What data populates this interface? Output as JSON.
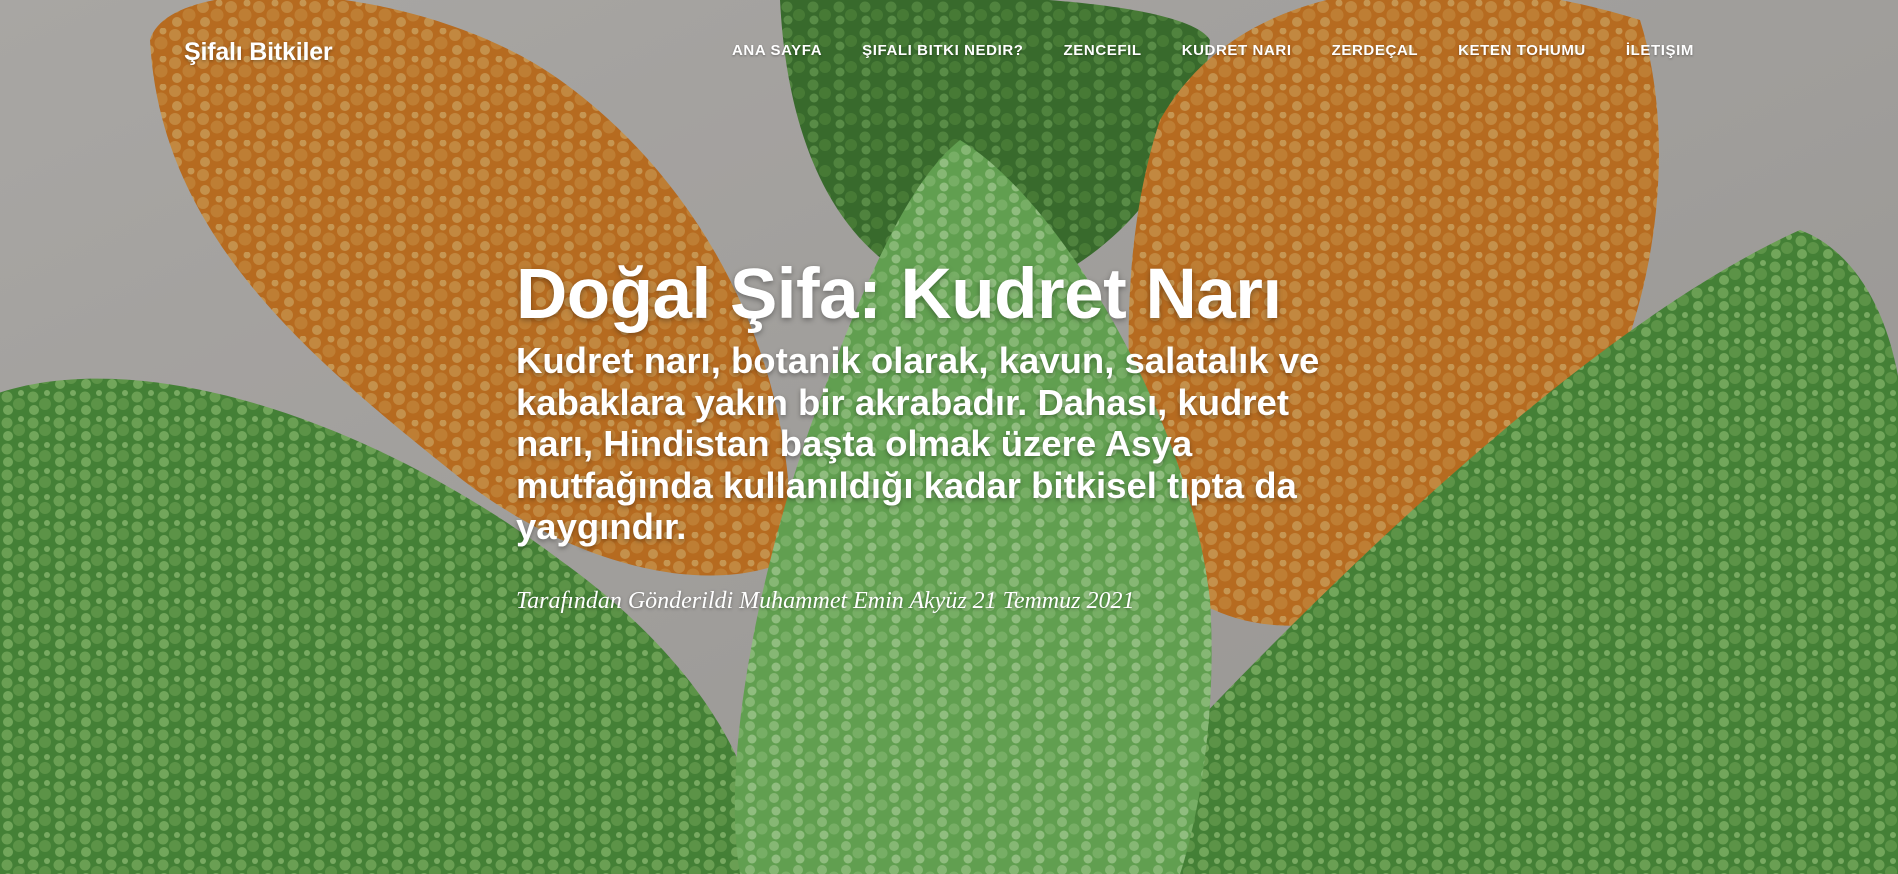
{
  "brand": {
    "name": "Şifalı Bitkiler"
  },
  "nav": {
    "items": [
      {
        "label": "ANA SAYFA"
      },
      {
        "label": "ŞIFALI BITKI NEDIR?"
      },
      {
        "label": "ZENCEFIL"
      },
      {
        "label": "KUDRET NARI"
      },
      {
        "label": "ZERDEÇAL"
      },
      {
        "label": "KETEN TOHUMU"
      },
      {
        "label": "İLETIŞIM"
      }
    ]
  },
  "post": {
    "title": "Doğal Şifa: Kudret Narı",
    "subtitle": "Kudret narı, botanik olarak, kavun, salatalık ve kabaklara yakın bir akrabadır. Dahası, kudret narı, Hindistan başta olmak üzere Asya mutfağında kullanıldığı kadar bitkisel tıpta da yaygındır.",
    "meta": {
      "prefix": "Tarafından Gönderildi",
      "author": "Muhammet Emin Akyüz",
      "date": "21 Temmuz 2021"
    }
  },
  "colors": {
    "text": "#ffffff",
    "orange_gourd": "#e8922a",
    "green_gourd": "#78b956",
    "background": "#c7c4bf"
  }
}
